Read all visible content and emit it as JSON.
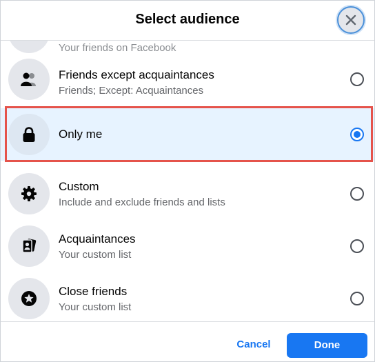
{
  "dialog": {
    "title": "Select audience",
    "close_icon": "close-x-icon"
  },
  "options": [
    {
      "label": "",
      "sub": "Your friends on Facebook",
      "icon": "friends-icon",
      "selected": false
    },
    {
      "label": "Friends except acquaintances",
      "sub": "Friends; Except: Acquaintances",
      "icon": "friends-except-icon",
      "selected": false
    },
    {
      "label": "Only me",
      "sub": "",
      "icon": "lock-icon",
      "selected": true
    },
    {
      "label": "Custom",
      "sub": "Include and exclude friends and lists",
      "icon": "gear-icon",
      "selected": false
    },
    {
      "label": "Acquaintances",
      "sub": "Your custom list",
      "icon": "acquaintances-list-icon",
      "selected": false
    },
    {
      "label": "Close friends",
      "sub": "Your custom list",
      "icon": "star-icon",
      "selected": false
    }
  ],
  "footer": {
    "cancel_label": "Cancel",
    "done_label": "Done"
  },
  "colors": {
    "accent": "#1877f2",
    "selected_bg": "#e7f3ff",
    "highlight_border": "#e5534b"
  }
}
